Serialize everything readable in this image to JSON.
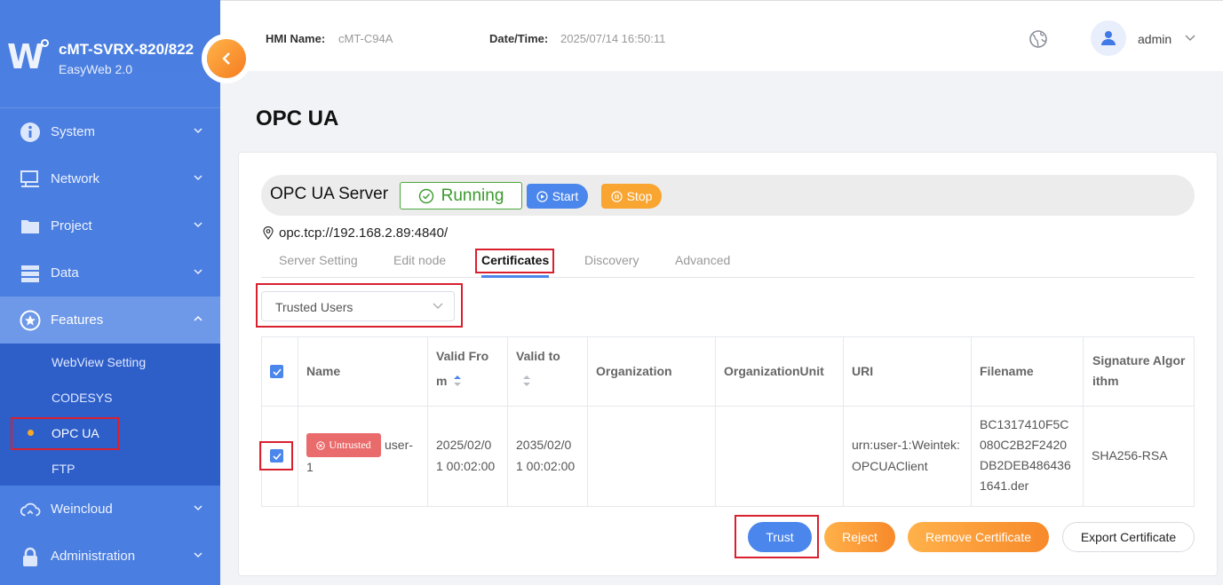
{
  "app": {
    "model": "cMT-SVRX-820/822",
    "product": "EasyWeb 2.0",
    "logo_letter": "W"
  },
  "sidebar": {
    "items": [
      {
        "label": "System",
        "icon": "info-icon"
      },
      {
        "label": "Network",
        "icon": "monitor-network-icon"
      },
      {
        "label": "Project",
        "icon": "folder-icon"
      },
      {
        "label": "Data",
        "icon": "database-icon"
      },
      {
        "label": "Features",
        "icon": "star-icon"
      },
      {
        "label": "Weincloud",
        "icon": "cloud-icon"
      },
      {
        "label": "Administration",
        "icon": "lock-icon"
      }
    ],
    "submenu": [
      {
        "label": "WebView Setting"
      },
      {
        "label": "CODESYS"
      },
      {
        "label": "OPC UA"
      },
      {
        "label": "FTP"
      }
    ]
  },
  "header": {
    "hmi_name_label": "HMI Name:",
    "hmi_name": "cMT-C94A",
    "datetime_label": "Date/Time:",
    "datetime": "2025/07/14 16:50:11",
    "user": "admin"
  },
  "page": {
    "title": "OPC UA"
  },
  "server": {
    "title": "OPC UA Server",
    "status": "Running",
    "start_label": "Start",
    "stop_label": "Stop",
    "endpoint": "opc.tcp://192.168.2.89:4840/"
  },
  "tabs": [
    "Server Setting",
    "Edit node",
    "Certificates",
    "Discovery",
    "Advanced"
  ],
  "filter": {
    "selected": "Trusted Users"
  },
  "table": {
    "headers": {
      "name": "Name",
      "valid_from_1": "Valid Fro",
      "valid_from_2": "m",
      "valid_to": "Valid to",
      "organization": "Organization",
      "org_unit": "OrganizationUnit",
      "uri": "URI",
      "filename": "Filename",
      "sig_1": "Signature Algor",
      "sig_2": "ithm"
    },
    "rows": [
      {
        "badge": "Untrusted",
        "name_1": "user-",
        "name_2": "1",
        "valid_from_1": "2025/02/0",
        "valid_from_2": "1 00:02:00",
        "valid_to_1": "2035/02/0",
        "valid_to_2": "1 00:02:00",
        "organization": "",
        "org_unit": "",
        "uri_1": "urn:user-1:Weintek:",
        "uri_2": "OPCUAClient",
        "filename_1": "BC1317410F5C",
        "filename_2": "080C2B2F2420",
        "filename_3": "DB2DEB486436",
        "filename_4": "1641.der",
        "signature": "SHA256-RSA"
      }
    ]
  },
  "actions": {
    "trust": "Trust",
    "reject": "Reject",
    "remove": "Remove Certificate",
    "export": "Export Certificate"
  },
  "colors": {
    "sidebar": "#4a7ee0",
    "submenu": "#2e5fc9",
    "primary": "#4b86ec",
    "warning": "#f9a531",
    "running": "#3a9a2c",
    "danger": "#ea6b6b",
    "highlight": "#d9202e"
  }
}
